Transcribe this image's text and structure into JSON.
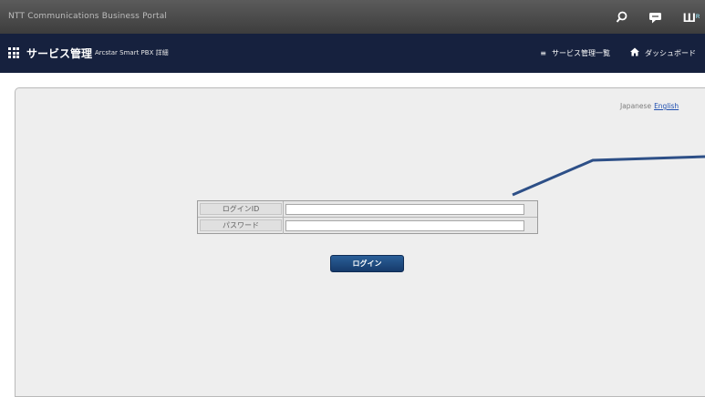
{
  "topbar": {
    "brand": "NTT Communications Business Portal",
    "icons": [
      "search-icon",
      "chat-icon",
      "logo-icon"
    ],
    "logo_text": "Ш",
    "logo_small": "R"
  },
  "nav": {
    "title": "サービス管理",
    "subtitle": "Arcstar Smart PBX 詳細",
    "menu": [
      {
        "icon": "list-icon",
        "label": "サービス管理一覧"
      },
      {
        "icon": "home-icon",
        "label": "ダッシュボード"
      }
    ]
  },
  "language": {
    "japanese": "Japanese",
    "english": "English"
  },
  "login": {
    "id_label": "ログインID",
    "id_value": "",
    "password_label": "パスワード",
    "password_value": "",
    "button": "ログイン"
  },
  "colors": {
    "topbar": "#4a4a4a",
    "nav": "#16213e",
    "button": "#1f4f86",
    "arrow": "#2d4f87"
  }
}
